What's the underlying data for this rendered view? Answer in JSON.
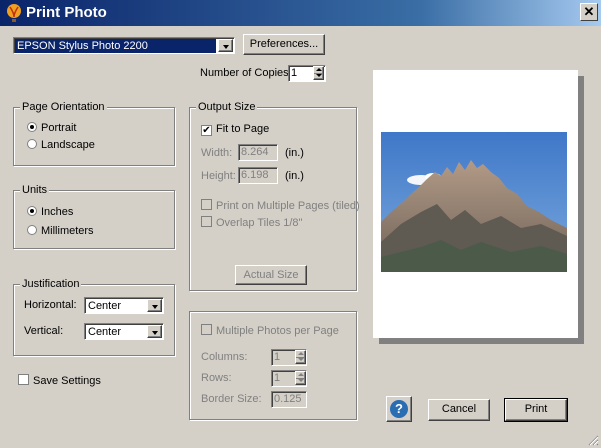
{
  "window": {
    "title": "Print Photo",
    "close": "✕"
  },
  "printer": {
    "selected": "EPSON Stylus Photo 2200",
    "preferences": "Preferences..."
  },
  "copies": {
    "label": "Number of Copies:",
    "value": "1"
  },
  "orientation": {
    "legend": "Page Orientation",
    "portrait": "Portrait",
    "landscape": "Landscape",
    "selected": "Portrait"
  },
  "units": {
    "legend": "Units",
    "inches": "Inches",
    "millimeters": "Millimeters",
    "selected": "Inches"
  },
  "justification": {
    "legend": "Justification",
    "horizontal_label": "Horizontal:",
    "horizontal_value": "Center",
    "vertical_label": "Vertical:",
    "vertical_value": "Center"
  },
  "save_settings": {
    "label": "Save Settings",
    "checked": false
  },
  "output_size": {
    "legend": "Output Size",
    "fit_to_page": "Fit to Page",
    "fit_checked": true,
    "width_label": "Width:",
    "width_value": "8.264",
    "width_unit": "(in.)",
    "height_label": "Height:",
    "height_value": "6.198",
    "height_unit": "(in.)",
    "multi_pages": "Print on Multiple Pages (tiled)",
    "overlap": "Overlap Tiles 1/8\"",
    "actual_size": "Actual Size"
  },
  "multi_photos": {
    "label": "Multiple Photos per Page",
    "columns_label": "Columns:",
    "columns_value": "1",
    "rows_label": "Rows:",
    "rows_value": "1",
    "border_label": "Border Size:",
    "border_value": "0.125"
  },
  "buttons": {
    "help": "?",
    "cancel": "Cancel",
    "print": "Print"
  },
  "colors": {
    "titlebar": "#0a246a",
    "face": "#d4d0c8",
    "help": "#2a6db3"
  }
}
